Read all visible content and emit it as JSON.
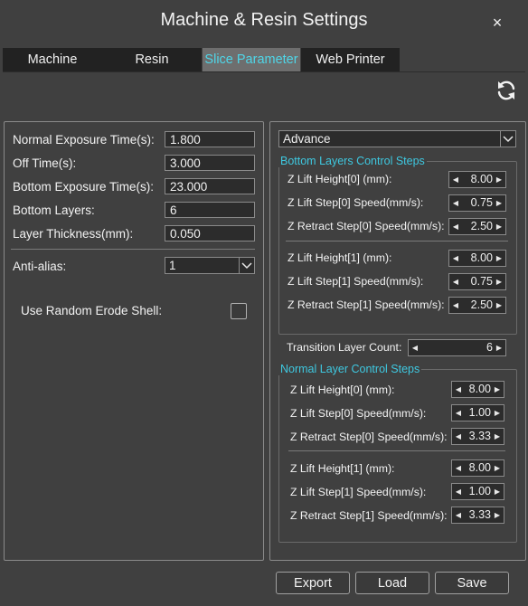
{
  "window": {
    "title": "Machine & Resin Settings",
    "close_label": "×"
  },
  "tabs": [
    "Machine",
    "Resin",
    "Slice Parameter",
    "Web Printer"
  ],
  "left": {
    "normal_exposure": {
      "label": "Normal Exposure Time(s):",
      "value": "1.800"
    },
    "off_time": {
      "label": "Off Time(s):",
      "value": "3.000"
    },
    "bottom_exposure": {
      "label": "Bottom Exposure Time(s):",
      "value": "23.000"
    },
    "bottom_layers": {
      "label": "Bottom Layers:",
      "value": "6"
    },
    "layer_thickness": {
      "label": "Layer Thickness(mm):",
      "value": "0.050"
    },
    "anti_alias": {
      "label": "Anti-alias:",
      "value": "1"
    },
    "random_erode": {
      "label": "Use Random Erode Shell:",
      "checked": false
    }
  },
  "right": {
    "mode": "Advance",
    "bottom_group": {
      "title": "Bottom Layers Control Steps",
      "rows": [
        {
          "label": "Z Lift Height[0] (mm):",
          "value": "8.00"
        },
        {
          "label": "Z Lift Step[0] Speed(mm/s):",
          "value": "0.75"
        },
        {
          "label": "Z Retract Step[0] Speed(mm/s):",
          "value": "2.50"
        },
        {
          "label": "Z Lift Height[1] (mm):",
          "value": "8.00"
        },
        {
          "label": "Z Lift Step[1] Speed(mm/s):",
          "value": "0.75"
        },
        {
          "label": "Z Retract Step[1] Speed(mm/s):",
          "value": "2.50"
        }
      ]
    },
    "transition": {
      "label": "Transition Layer Count:",
      "value": "6"
    },
    "normal_group": {
      "title": "Normal Layer Control Steps",
      "rows": [
        {
          "label": "Z Lift Height[0] (mm):",
          "value": "8.00"
        },
        {
          "label": "Z Lift Step[0] Speed(mm/s):",
          "value": "1.00"
        },
        {
          "label": "Z Retract Step[0] Speed(mm/s):",
          "value": "3.33"
        },
        {
          "label": "Z Lift Height[1] (mm):",
          "value": "8.00"
        },
        {
          "label": "Z Lift Step[1] Speed(mm/s):",
          "value": "1.00"
        },
        {
          "label": "Z Retract Step[1] Speed(mm/s):",
          "value": "3.33"
        }
      ]
    }
  },
  "buttons": {
    "export": "Export",
    "load": "Load",
    "save": "Save"
  },
  "colors": {
    "background": "#404040",
    "accent": "#3ec8e0",
    "field": "#2c2c2c"
  },
  "icons": {
    "refresh": "refresh-icon",
    "close": "close-icon"
  }
}
